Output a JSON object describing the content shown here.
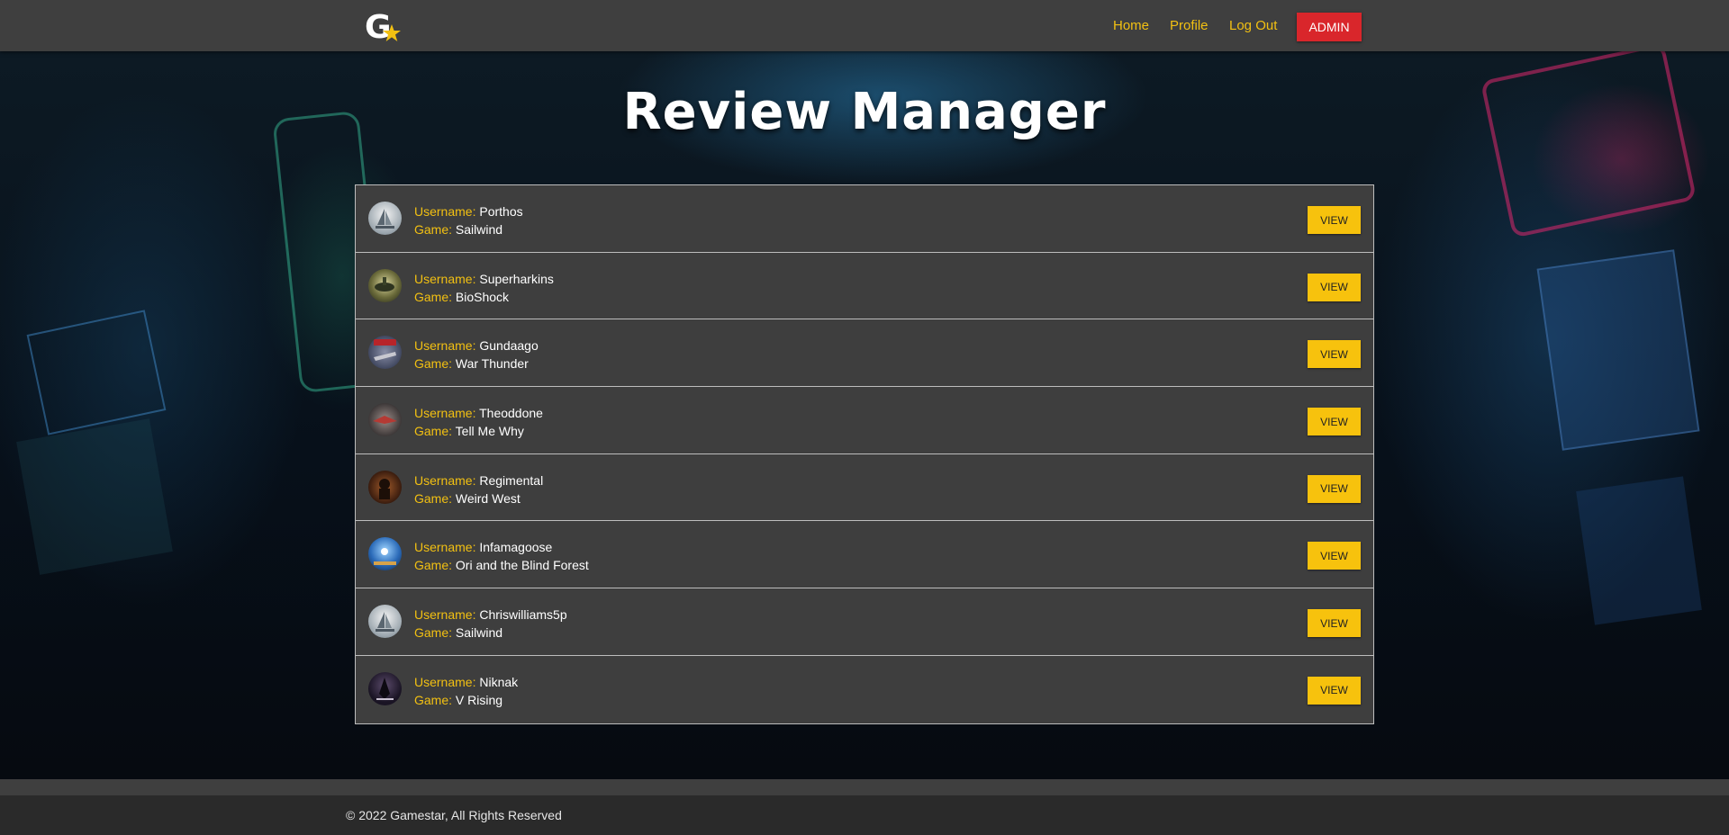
{
  "nav": {
    "logo_letter": "G",
    "links": [
      "Home",
      "Profile",
      "Log Out"
    ],
    "admin_label": "ADMIN"
  },
  "page": {
    "title": "Review Manager"
  },
  "reviews": {
    "username_label": "Username:",
    "game_label": "Game:",
    "view_label": "VIEW",
    "items": [
      {
        "username": "Porthos",
        "game": "Sailwind"
      },
      {
        "username": "Superharkins",
        "game": "BioShock"
      },
      {
        "username": "Gundaago",
        "game": "War Thunder"
      },
      {
        "username": "Theoddone",
        "game": "Tell Me Why"
      },
      {
        "username": "Regimental",
        "game": "Weird West"
      },
      {
        "username": "Infamagoose",
        "game": "Ori and the Blind Forest"
      },
      {
        "username": "Chriswilliams5p",
        "game": "Sailwind"
      },
      {
        "username": "Niknak",
        "game": "V Rising"
      }
    ]
  },
  "footer": {
    "copyright": "© 2022 Gamestar, All Rights Reserved"
  },
  "colors": {
    "accent": "#f2c012",
    "admin": "#d9262b",
    "header_bg": "#3f3f3f",
    "row_bg": "#3e3e3e"
  }
}
